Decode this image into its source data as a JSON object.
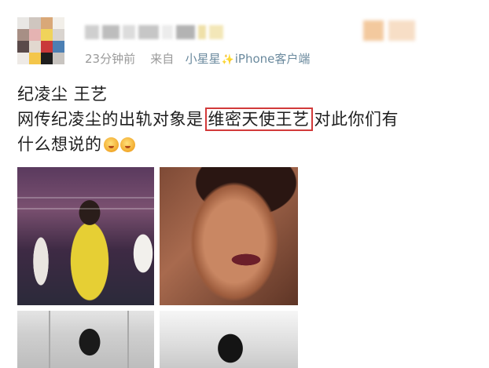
{
  "post": {
    "meta": {
      "time": "23分钟前",
      "from": "来自",
      "source_name": "小星星",
      "sparkle_icon": "sparkle-icon",
      "client": "iPhone客户端"
    },
    "line1": "纪凌尘 王艺",
    "line2_before": "网传纪凌尘的出轨对象是",
    "line2_highlight": "维密天使王艺",
    "line2_after": "对此你们有",
    "line3": "什么想说的",
    "emoji_icon": "drooling-face-emoji",
    "highlight_color": "#d23a3a"
  }
}
